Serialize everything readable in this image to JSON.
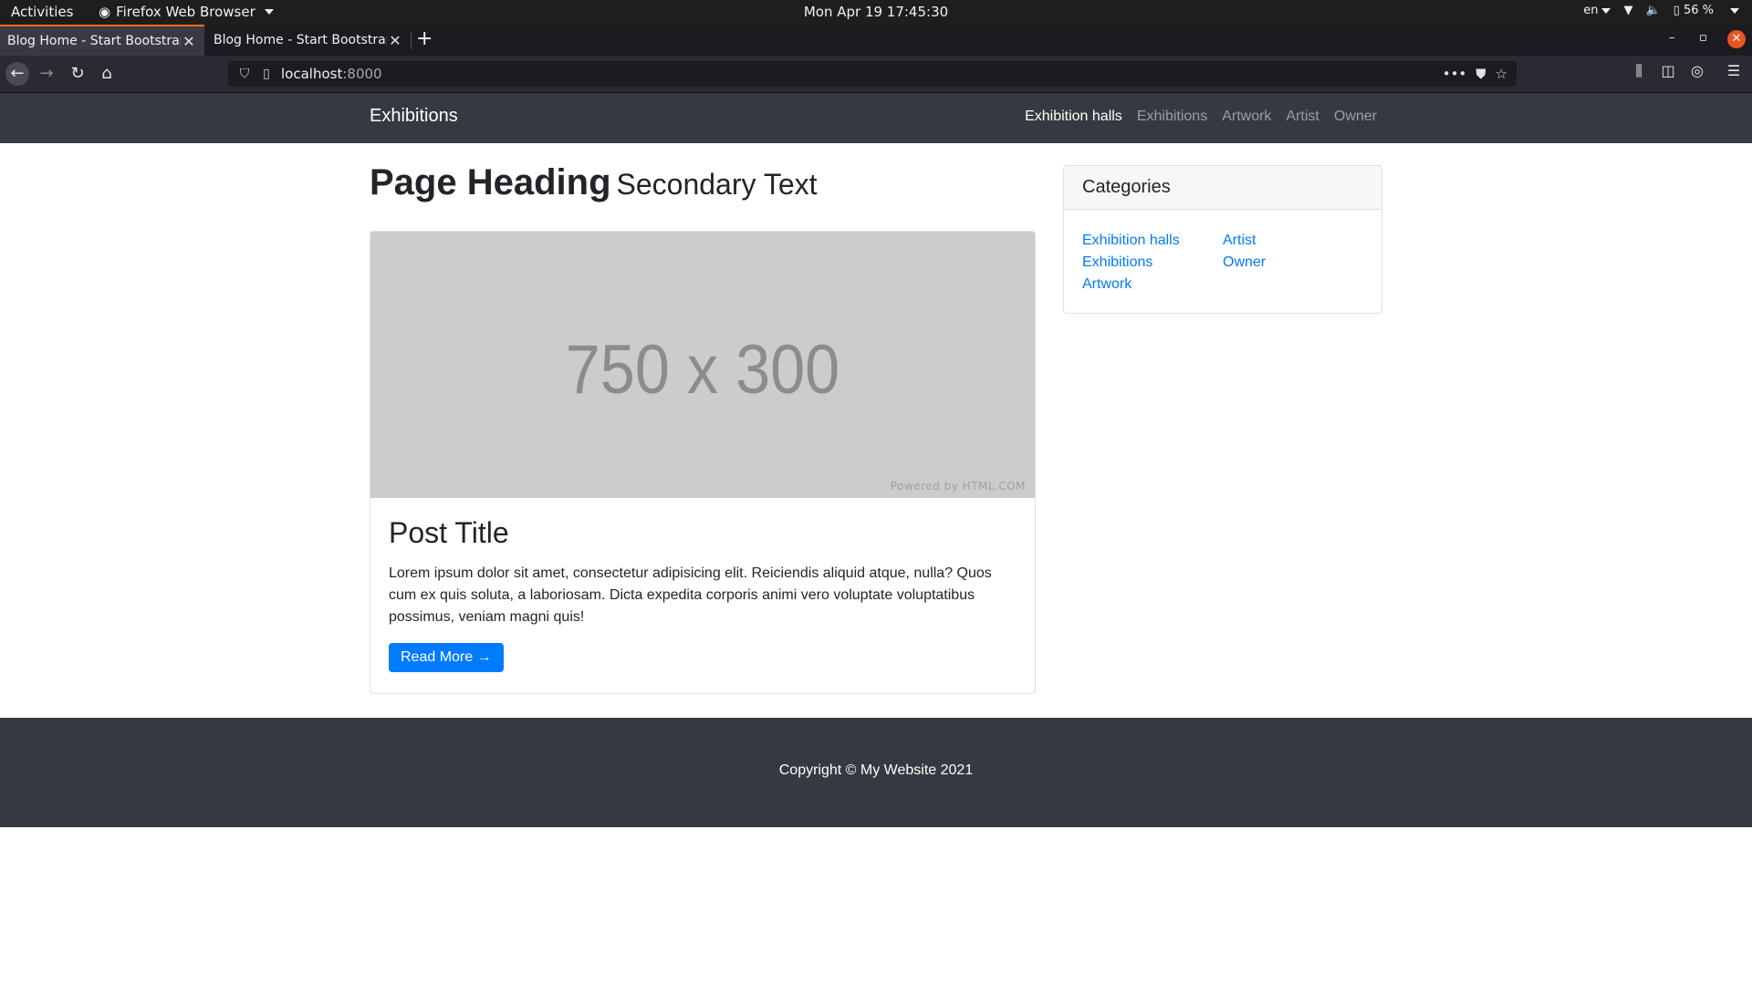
{
  "os": {
    "activities": "Activities",
    "app_name": "Firefox Web Browser",
    "clock": "Mon Apr 19  17:45:30",
    "lang": "en",
    "battery": "56 %"
  },
  "browser": {
    "tabs": [
      {
        "title": "Blog Home - Start Bootstrap"
      },
      {
        "title": "Blog Home - Start Bootstrap"
      }
    ],
    "url_host": "localhost",
    "url_port": ":8000"
  },
  "site": {
    "brand": "Exhibitions",
    "nav": [
      {
        "label": "Exhibition halls"
      },
      {
        "label": "Exhibitions"
      },
      {
        "label": "Artwork"
      },
      {
        "label": "Artist"
      },
      {
        "label": "Owner"
      }
    ],
    "heading_main": "Page Heading",
    "heading_sub": "Secondary Text",
    "post": {
      "image_text": "750 x 300",
      "image_credit": "Powered by HTML.COM",
      "title": "Post Title",
      "text": "Lorem ipsum dolor sit amet, consectetur adipisicing elit. Reiciendis aliquid atque, nulla? Quos cum ex quis soluta, a laboriosam. Dicta expedita corporis animi vero voluptate voluptatibus possimus, veniam magni quis!",
      "button": "Read More →"
    },
    "categories": {
      "title": "Categories",
      "col1": [
        "Exhibition halls",
        "Exhibitions",
        "Artwork"
      ],
      "col2": [
        "Artist",
        "Owner"
      ]
    },
    "footer": "Copyright © My Website 2021"
  }
}
